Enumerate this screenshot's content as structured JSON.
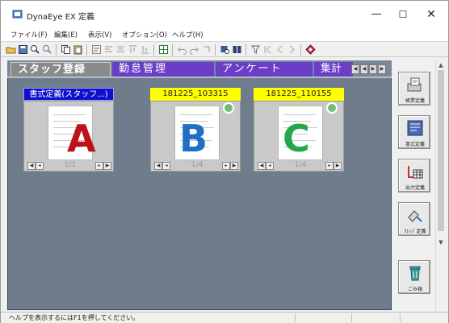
{
  "window": {
    "title": "DynaEye EX 定義",
    "controls": [
      "minimize",
      "maximize",
      "close"
    ]
  },
  "menu": [
    {
      "label": "ファイル(F)"
    },
    {
      "label": "編集(E)"
    },
    {
      "label": "表示(V)"
    },
    {
      "label": "オプション(O)"
    },
    {
      "label": "ヘルプ(H)"
    }
  ],
  "tabs": [
    {
      "label": "スタッフ登録",
      "active": true
    },
    {
      "label": "勤怠管理",
      "active": false
    },
    {
      "label": "アンケート",
      "active": false
    },
    {
      "label": "集計",
      "active": false
    }
  ],
  "cards": [
    {
      "label": "書式定義(スタッフ...)",
      "label_style": "blue",
      "page": "1/1",
      "letter": "A",
      "letter_color": "#c0101a",
      "check_badge": false
    },
    {
      "label": "181225_103315",
      "label_style": "yellow",
      "page": "1/4",
      "letter": "B",
      "letter_color": "#1f6fc4",
      "check_badge": true
    },
    {
      "label": "181225_110155",
      "label_style": "yellow",
      "page": "1/4",
      "letter": "C",
      "letter_color": "#22a84a",
      "check_badge": true
    }
  ],
  "side_buttons": [
    {
      "label": "帳票定義",
      "icon": "form-definition-icon"
    },
    {
      "label": "書式定義",
      "icon": "format-definition-icon"
    },
    {
      "label": "出力定義",
      "icon": "output-definition-icon"
    },
    {
      "label": "ｸﾚﾝｼﾞ定義",
      "icon": "cleansing-definition-icon"
    },
    {
      "label": "ごみ箱",
      "icon": "trash-icon"
    }
  ],
  "status": {
    "text": "ヘルプを表示するにはF1を押してください。"
  },
  "colors": {
    "workspace": "#6e7c8c",
    "tab_inactive": "#6a3ec9",
    "label_blue": "#1010cc",
    "label_yellow": "#ffff00"
  }
}
